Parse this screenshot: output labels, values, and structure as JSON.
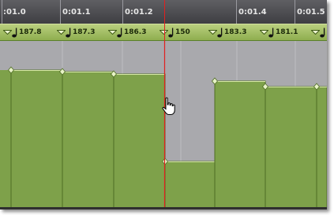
{
  "ruler": {
    "ticks": [
      ":01.0",
      "0:01.1",
      "0:01.2",
      "0:01.4",
      "0:01.5"
    ]
  },
  "tempo_ruler": {
    "markers": [
      "187.8",
      "187.3",
      "186.3",
      "150",
      "183.3",
      "181.1"
    ]
  },
  "tempo_graph": {
    "values": [
      187.8,
      187.3,
      186.3,
      150,
      183.3,
      181.1
    ],
    "view_range": [
      130,
      200
    ]
  },
  "colors": {
    "ruler_bg": "#4a4a4e",
    "tempo_bar": "#a8c36a",
    "graph_bg": "#a9a9ad",
    "graph_fill": "#7ea14a",
    "playhead": "#e02020"
  },
  "cursor": {
    "icon": "hand-pointer-icon"
  }
}
